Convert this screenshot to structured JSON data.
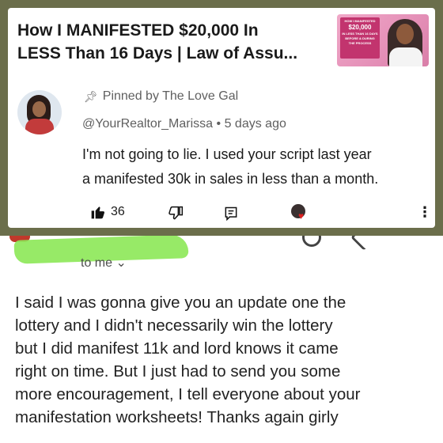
{
  "video": {
    "title_line1": "How I MANIFESTED $20,000 In",
    "title_line2": "LESS Than 16 Days | Law of Assu...",
    "thumbnail": {
      "line1": "HOW I MANIFESTED",
      "amount": "$20,000",
      "line2": "IN LESS THAN 16 DAYS",
      "line3": "BEFORE & DURING",
      "line4": "THE PROCESS"
    }
  },
  "comment": {
    "pinned_label": "Pinned by The Love Gal",
    "author": "@YourRealtor_Marissa",
    "separator": "•",
    "time": "5 days ago",
    "text_line1": "I'm not going to lie. I used your script last year",
    "text_line2": "a manifested 30k in sales in less than a month.",
    "likes": "36",
    "icons": {
      "pin": "pin-icon",
      "like": "thumbs-up-icon",
      "dislike": "thumbs-down-icon",
      "reply": "reply-icon",
      "creator_heart": "creator-heart-icon",
      "more": "more-vertical-icon"
    }
  },
  "email": {
    "recipient_label": "to me",
    "body_lines": [
      "I said I was gonna give you an update one the",
      "lottery and I didn't necessarily win the lottery",
      "but I did manifest 11k and lord knows it came",
      "right on time. But I just had to send you some",
      "more encouragement, I tell everyone about your",
      "manifestation worksheets! Thanks again girly"
    ]
  },
  "colors": {
    "background": "#6b6e4b",
    "redaction": "#8ee85a",
    "heart": "#e02020"
  }
}
